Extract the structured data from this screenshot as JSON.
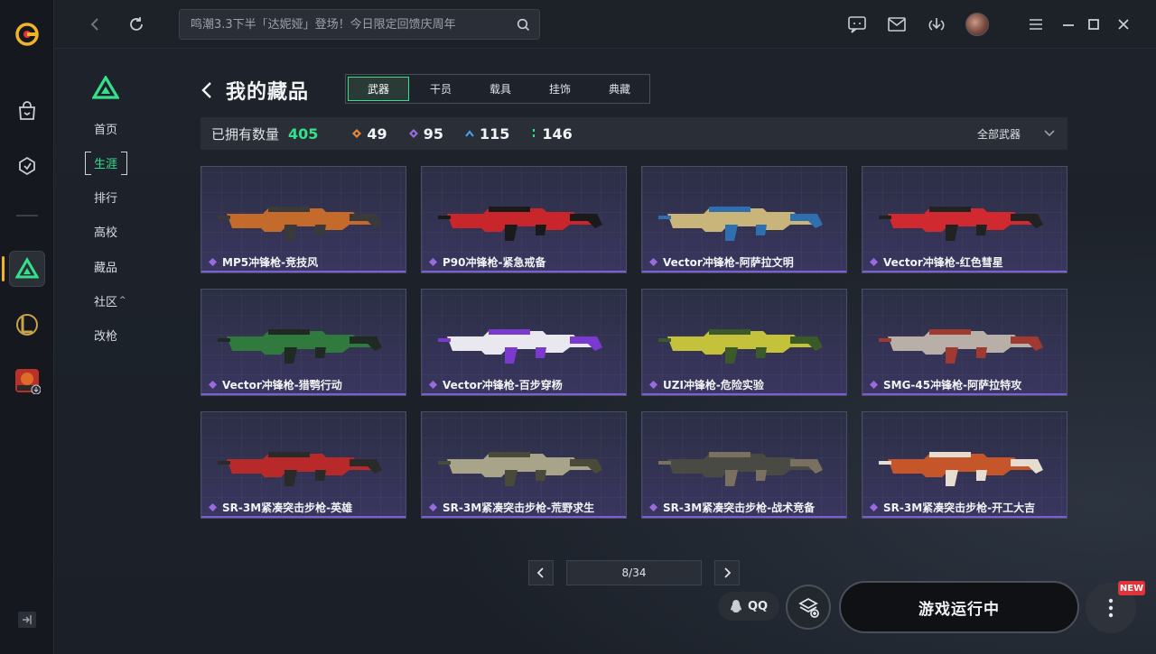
{
  "search": {
    "placeholder": "鸣潮3.3下半「达妮娅」登场！今日限定回馈庆周年"
  },
  "subnav": {
    "items": [
      {
        "label": "首页",
        "active": false
      },
      {
        "label": "生涯",
        "active": true
      },
      {
        "label": "排行",
        "active": false
      },
      {
        "label": "高校",
        "active": false
      },
      {
        "label": "藏品",
        "active": false
      },
      {
        "label": "社区",
        "active": false,
        "caret": "^"
      },
      {
        "label": "改枪",
        "active": false
      }
    ]
  },
  "page": {
    "title": "我的藏品"
  },
  "tabs": [
    {
      "label": "武器",
      "active": true
    },
    {
      "label": "干员",
      "active": false
    },
    {
      "label": "载具",
      "active": false
    },
    {
      "label": "挂饰",
      "active": false
    },
    {
      "label": "典藏",
      "active": false
    }
  ],
  "stats": {
    "owned_label": "已拥有数量",
    "owned_total": "405",
    "tiers": [
      {
        "value": "49",
        "color": "#e8873a"
      },
      {
        "value": "95",
        "color": "#9b6ae0"
      },
      {
        "value": "115",
        "color": "#4a9be8"
      },
      {
        "value": "146",
        "color": "#35e08a"
      }
    ],
    "filter_label": "全部武器"
  },
  "cards": [
    {
      "name": "MP5冲锋枪-竞技风",
      "palette": [
        "#c46a2a",
        "#3a3a3a"
      ]
    },
    {
      "name": "P90冲锋枪-紧急戒备",
      "palette": [
        "#c8262a",
        "#1a1a1a"
      ]
    },
    {
      "name": "Vector冲锋枪-阿萨拉文明",
      "palette": [
        "#c9b47a",
        "#2f6fb0"
      ]
    },
    {
      "name": "Vector冲锋枪-红色彗星",
      "palette": [
        "#d02a30",
        "#222222"
      ]
    },
    {
      "name": "Vector冲锋枪-猎鹗行动",
      "palette": [
        "#2f7a3c",
        "#1e2a22"
      ]
    },
    {
      "name": "Vector冲锋枪-百步穿杨",
      "palette": [
        "#e8e8ee",
        "#7a3ad0"
      ]
    },
    {
      "name": "UZI冲锋枪-危险实验",
      "palette": [
        "#c4c23a",
        "#3a5a2a"
      ]
    },
    {
      "name": "SMG-45冲锋枪-阿萨拉特攻",
      "palette": [
        "#b8b0a8",
        "#a03a30"
      ]
    },
    {
      "name": "SR-3M紧凑突击步枪-英雄",
      "palette": [
        "#b82a2a",
        "#2a2a2a"
      ]
    },
    {
      "name": "SR-3M紧凑突击步枪-荒野求生",
      "palette": [
        "#a8a48a",
        "#4a4a3a"
      ]
    },
    {
      "name": "SR-3M紧凑突击步枪-战术竞备",
      "palette": [
        "#4a4a44",
        "#7a7060"
      ]
    },
    {
      "name": "SR-3M紧凑突击步枪-开工大吉",
      "palette": [
        "#c4562a",
        "#e6dcd0"
      ]
    }
  ],
  "pagination": {
    "current": "8/34"
  },
  "bottom": {
    "qq_label": "QQ",
    "launch_label": "游戏运行中",
    "new_badge": "NEW"
  },
  "colors": {
    "accent": "#35e08a",
    "rarity_purple": "#7b5fd0"
  }
}
